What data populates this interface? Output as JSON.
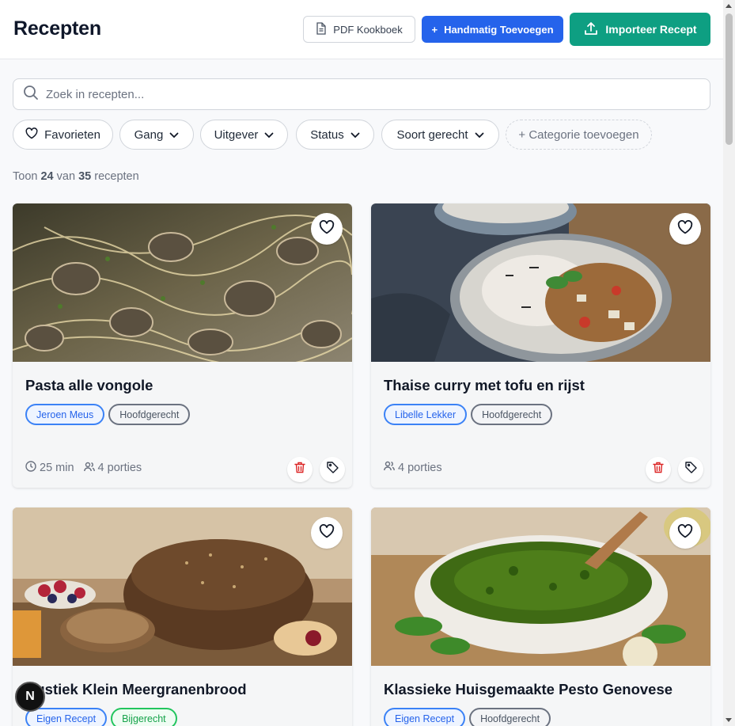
{
  "header": {
    "title": "Recepten",
    "pdf_label": "PDF Kookboek",
    "add_label": "Handmatig Toevoegen",
    "add_prefix": "+",
    "import_label": "Importeer Recept"
  },
  "search": {
    "placeholder": "Zoek in recepten..."
  },
  "filters": {
    "favorites": "Favorieten",
    "course": "Gang",
    "publisher": "Uitgever",
    "status": "Status",
    "dish_type": "Soort gerecht",
    "add_category": "+ Categorie toevoegen"
  },
  "count": {
    "prefix": "Toon",
    "shown": "24",
    "middle": "van",
    "total": "35",
    "suffix": "recepten"
  },
  "recipes": [
    {
      "title": "Pasta alle vongole",
      "tags": [
        "Jeroen Meus",
        "Hoofdgerecht"
      ],
      "time": "25 min",
      "portions": "4 porties"
    },
    {
      "title": "Thaise curry met tofu en rijst",
      "tags": [
        "Libelle Lekker",
        "Hoofdgerecht"
      ],
      "portions": "4 porties"
    },
    {
      "title": "Rustiek Klein Meergranenbrood",
      "tags": [
        "Eigen Recept",
        "Bijgerecht"
      ]
    },
    {
      "title": "Klassieke Huisgemaakte Pesto Genovese",
      "tags": [
        "Eigen Recept",
        "Hoofdgerecht"
      ]
    }
  ],
  "badge": {
    "letter": "N"
  },
  "colors": {
    "primary": "#2563eb",
    "import": "#0e9f82",
    "delete": "#dc2626"
  }
}
